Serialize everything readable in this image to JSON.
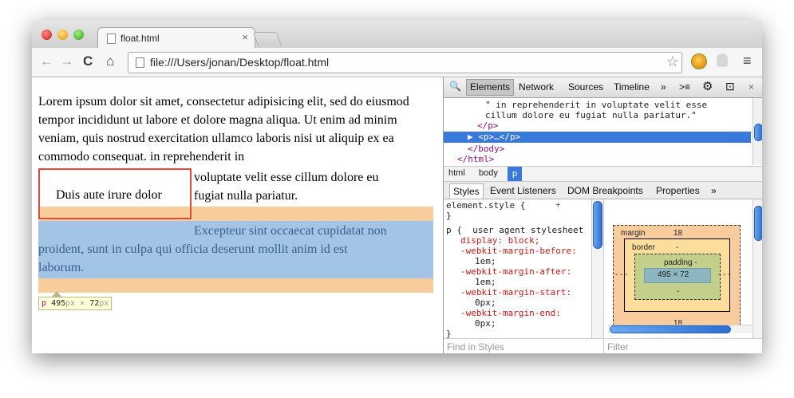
{
  "browser": {
    "tab_title": "float.html",
    "tab_close": "×",
    "url": "file:///Users/jonan/Desktop/float.html",
    "nav": {
      "back": "←",
      "forward": "→",
      "reload": "C",
      "home": "⌂"
    },
    "star": "☆",
    "menu": "≡"
  },
  "page": {
    "para1": "Lorem ipsum dolor sit amet, consectetur adipisicing elit, sed do eiusmod tempor incididunt ut labore et dolore magna aliqua. Ut enim ad minim veniam, quis nostrud exercitation ullamco laboris nisi ut aliquip ex ea commodo consequat. in reprehenderit in",
    "para2_line1": "voluptate velit esse cillum dolore eu",
    "para2_line2": "fugiat nulla pariatur.",
    "float_text": "Duis aute irure dolor",
    "hl_line1": "Excepteur sint occaecat cupidatat non",
    "hl_line2": "proident, sunt in culpa qui officia deserunt mollit anim id est",
    "hl_line3": "laborum.",
    "tooltip": {
      "tag": "p",
      "w": "495",
      "x": "×",
      "h": "72",
      "unit": "px"
    }
  },
  "devtools": {
    "toolbar": {
      "search_icon": "🔍",
      "elements": "Elements",
      "network": "Network",
      "sources": "Sources",
      "timeline": "Timeline",
      "more": "»",
      "console_icon": ">≡",
      "gear": "⚙",
      "dock": "⊡",
      "close": "×"
    },
    "dom": {
      "line1": "\" in reprehenderit in voluptate velit esse",
      "line2": "cillum dolore eu fugiat nulla pariatur.\"",
      "line3": "</p>",
      "line4": "▶ <p>…</p>",
      "line5": "</body>",
      "line6": "</html>"
    },
    "crumbs": [
      "html",
      "body",
      "p"
    ],
    "side_tabs": [
      "Styles",
      "Event Listeners",
      "DOM Breakpoints",
      "Properties",
      "»"
    ],
    "styles": {
      "l1": "element.style {",
      "l2": "}",
      "l3": "p {  user agent stylesheet",
      "l4": "display: block;",
      "l5": "-webkit-margin-before:",
      "l6": "1em;",
      "l7": "-webkit-margin-after:",
      "l8": "1em;",
      "l9": "-webkit-margin-start:",
      "l10": "0px;",
      "l11": "-webkit-margin-end:",
      "l12": "0px;",
      "l13": "}"
    },
    "metrics": {
      "margin_label": "margin",
      "margin_top": "18",
      "margin_bottom": "18",
      "border_label": "border",
      "border_val": "-",
      "padding_label": "padding -",
      "content": "495 × 72",
      "padding_bottom": "-",
      "side": "- - -"
    },
    "filter_styles": "Find in Styles",
    "filter_metrics": "Filter"
  },
  "colors": {
    "highlight_content": "#a2c4e6",
    "highlight_margin": "#f7cd9b",
    "float_border": "#e24a3a",
    "selection_blue": "#3879d9"
  }
}
